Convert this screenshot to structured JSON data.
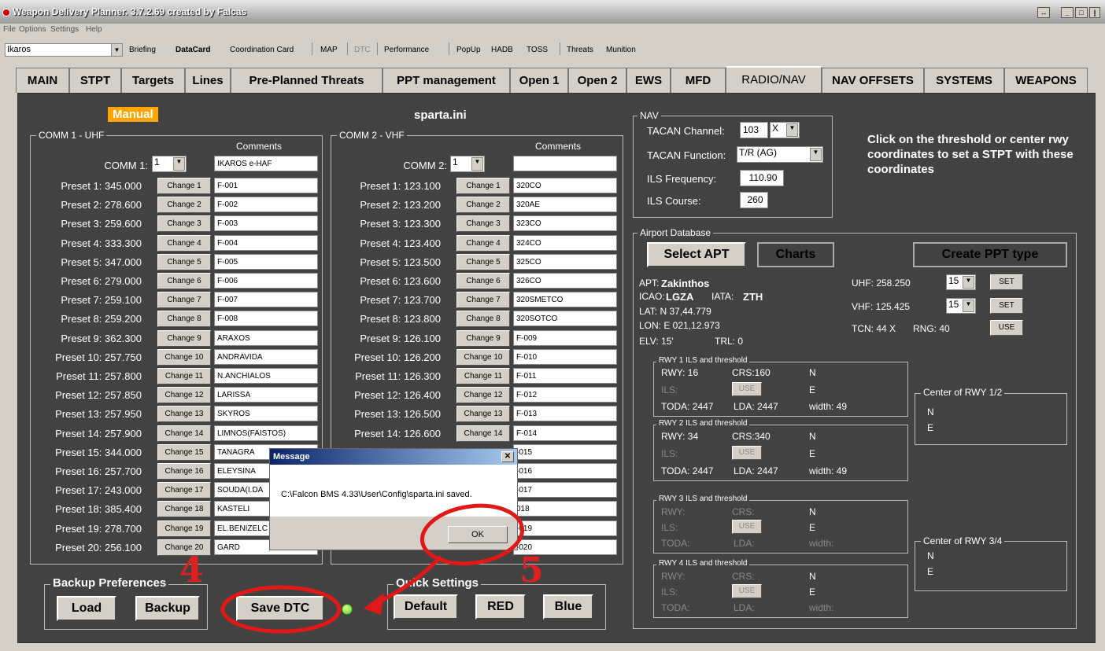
{
  "window": {
    "title": "Weapon Delivery Planner. 3.7.2.69 created by Falcas",
    "menu": [
      "File",
      "Options",
      "Settings",
      "Help"
    ]
  },
  "toolbar": {
    "profile": "Ikaros",
    "items": [
      "Briefing",
      "DataCard",
      "Coordination Card",
      "MAP",
      "DTC",
      "Performance",
      "PopUp",
      "HADB",
      "TOSS",
      "Threats",
      "Munition"
    ]
  },
  "tabs": [
    "MAIN",
    "STPT",
    "Targets",
    "Lines",
    "Pre-Planned Threats",
    "PPT management",
    "Open 1",
    "Open 2",
    "EWS",
    "MFD",
    "RADIO/NAV",
    "NAV OFFSETS",
    "SYSTEMS",
    "WEAPONS"
  ],
  "header": {
    "mode": "Manual",
    "file": "sparta.ini"
  },
  "comm1": {
    "group": "COMM 1 - UHF",
    "comments_header": "Comments",
    "comm_label": "COMM 1:",
    "comm_value": "1",
    "comm_comment": "IKAROS e-HAF",
    "presets": [
      {
        "label": "Preset 1: 345.000",
        "btn": "Change 1",
        "comment": "F-001"
      },
      {
        "label": "Preset 2: 278.600",
        "btn": "Change 2",
        "comment": "F-002"
      },
      {
        "label": "Preset 3: 259.600",
        "btn": "Change 3",
        "comment": "F-003"
      },
      {
        "label": "Preset 4: 333.300",
        "btn": "Change 4",
        "comment": "F-004"
      },
      {
        "label": "Preset 5: 347.000",
        "btn": "Change 5",
        "comment": "F-005"
      },
      {
        "label": "Preset 6: 279.000",
        "btn": "Change 6",
        "comment": "F-006"
      },
      {
        "label": "Preset 7: 259.100",
        "btn": "Change 7",
        "comment": "F-007"
      },
      {
        "label": "Preset 8: 259.200",
        "btn": "Change 8",
        "comment": "F-008"
      },
      {
        "label": "Preset 9: 362.300",
        "btn": "Change 9",
        "comment": "ARAXOS"
      },
      {
        "label": "Preset 10: 257.750",
        "btn": "Change 10",
        "comment": "ANDRAVIDA"
      },
      {
        "label": "Preset 11: 257.800",
        "btn": "Change 11",
        "comment": "N.ANCHIALOS"
      },
      {
        "label": "Preset 12: 257.850",
        "btn": "Change 12",
        "comment": "LARISSA"
      },
      {
        "label": "Preset 13: 257.950",
        "btn": "Change 13",
        "comment": "SKYROS"
      },
      {
        "label": "Preset 14: 257.900",
        "btn": "Change 14",
        "comment": "LIMNOS(FAISTOS)"
      },
      {
        "label": "Preset 15: 344.000",
        "btn": "Change 15",
        "comment": "TANAGRA"
      },
      {
        "label": "Preset 16: 257.700",
        "btn": "Change 16",
        "comment": "ELEYSINA"
      },
      {
        "label": "Preset 17: 243.000",
        "btn": "Change 17",
        "comment": "SOUDA(I.DA"
      },
      {
        "label": "Preset 18: 385.400",
        "btn": "Change 18",
        "comment": "KASTELI"
      },
      {
        "label": "Preset 19: 278.700",
        "btn": "Change 19",
        "comment": "EL.BENIZELC"
      },
      {
        "label": "Preset 20: 256.100",
        "btn": "Change 20",
        "comment": "GARD"
      }
    ]
  },
  "comm2": {
    "group": "COMM 2 - VHF",
    "comments_header": "Comments",
    "comm_label": "COMM 2:",
    "comm_value": "1",
    "comm_comment": "",
    "presets": [
      {
        "label": "Preset 1: 123.100",
        "btn": "Change 1",
        "comment": "320CO"
      },
      {
        "label": "Preset 2: 123.200",
        "btn": "Change 2",
        "comment": "320AE"
      },
      {
        "label": "Preset 3: 123.300",
        "btn": "Change 3",
        "comment": "323CO"
      },
      {
        "label": "Preset 4: 123.400",
        "btn": "Change 4",
        "comment": "324CO"
      },
      {
        "label": "Preset 5: 123.500",
        "btn": "Change 5",
        "comment": "325CO"
      },
      {
        "label": "Preset 6: 123.600",
        "btn": "Change 6",
        "comment": "326CO"
      },
      {
        "label": "Preset 7: 123.700",
        "btn": "Change 7",
        "comment": "320SMETCO"
      },
      {
        "label": "Preset 8: 123.800",
        "btn": "Change 8",
        "comment": "320SOTCO"
      },
      {
        "label": "Preset 9: 126.100",
        "btn": "Change 9",
        "comment": "F-009"
      },
      {
        "label": "Preset 10: 126.200",
        "btn": "Change 10",
        "comment": "F-010"
      },
      {
        "label": "Preset 11: 126.300",
        "btn": "Change 11",
        "comment": "F-011"
      },
      {
        "label": "Preset 12: 126.400",
        "btn": "Change 12",
        "comment": "F-012"
      },
      {
        "label": "Preset 13: 126.500",
        "btn": "Change 13",
        "comment": "F-013"
      },
      {
        "label": "Preset 14: 126.600",
        "btn": "Change 14",
        "comment": "F-014"
      },
      {
        "comment": "-015"
      },
      {
        "comment": "-016"
      },
      {
        "comment": "-017"
      },
      {
        "comment": "018"
      },
      {
        "comment": "-019"
      },
      {
        "comment": "-020"
      }
    ]
  },
  "nav": {
    "group": "NAV",
    "tacan_channel_label": "TACAN Channel:",
    "tacan_channel": "103",
    "tacan_band": "X",
    "tacan_function_label": "TACAN Function:",
    "tacan_function": "T/R (AG)",
    "ils_freq_label": "ILS Frequency:",
    "ils_freq": "110.90",
    "ils_course_label": "ILS Course:",
    "ils_course": "260",
    "hint": "Click on the threshold or center rwy coordinates to set a STPT with these coordinates"
  },
  "airport": {
    "group": "Airport Database",
    "select_apt": "Select APT",
    "charts": "Charts",
    "create_ppt": "Create PPT type",
    "apt_label": "APT:",
    "apt": "Zakinthos",
    "icao_label": "ICAO:",
    "icao": "LGZA",
    "iata_label": "IATA:",
    "iata": "ZTH",
    "lat": "LAT:   N  37,44.779",
    "lon": "LON:  E 021,12.973",
    "elv": "ELV:  15'",
    "trl": "TRL:  0",
    "uhf": "UHF: 258.250",
    "uhf_sel": "15",
    "vhf": "VHF: 125.425",
    "vhf_sel": "15",
    "set": "SET",
    "tcn": "TCN: 44 X",
    "rng": "RNG: 40",
    "use": "USE",
    "rwy1": {
      "title": "RWY 1 ILS and threshold",
      "rwy": "RWY: 16",
      "crs": "CRS:160",
      "n": "N",
      "ils": "ILS:",
      "use": "USE",
      "e": "E",
      "toda": "TODA: 2447",
      "lda": "LDA: 2447",
      "width": "width: 49"
    },
    "rwy2": {
      "title": "RWY 2 ILS and threshold",
      "rwy": "RWY: 34",
      "crs": "CRS:340",
      "n": "N",
      "ils": "ILS:",
      "use": "USE",
      "e": "E",
      "toda": "TODA: 2447",
      "lda": "LDA: 2447",
      "width": "width: 49"
    },
    "rwy3": {
      "title": "RWY 3 ILS and threshold",
      "rwy": "RWY:",
      "crs": "CRS:",
      "n": "N",
      "ils": "ILS:",
      "use": "USE",
      "e": "E",
      "toda": "TODA:",
      "lda": "LDA:",
      "width": "width:"
    },
    "rwy4": {
      "title": "RWY 4 ILS and threshold",
      "rwy": "RWY:",
      "crs": "CRS:",
      "n": "N",
      "ils": "ILS:",
      "use": "USE",
      "e": "E",
      "toda": "TODA:",
      "lda": "LDA:",
      "width": "width:"
    },
    "center12": {
      "title": "Center of RWY 1/2",
      "n": "N",
      "e": "E"
    },
    "center34": {
      "title": "Center of RWY 3/4",
      "n": "N",
      "e": "E"
    }
  },
  "backup": {
    "group": "Backup Preferences",
    "load": "Load",
    "backup": "Backup"
  },
  "save_dtc": "Save DTC",
  "quick": {
    "group": "Quick Settings",
    "default": "Default",
    "red": "RED",
    "blue": "Blue"
  },
  "dialog": {
    "title": "Message",
    "text": "C:\\Falcon BMS 4.33\\User\\Config\\sparta.ini saved.",
    "ok": "OK"
  },
  "annotations": {
    "n4": "4",
    "n5": "5"
  }
}
